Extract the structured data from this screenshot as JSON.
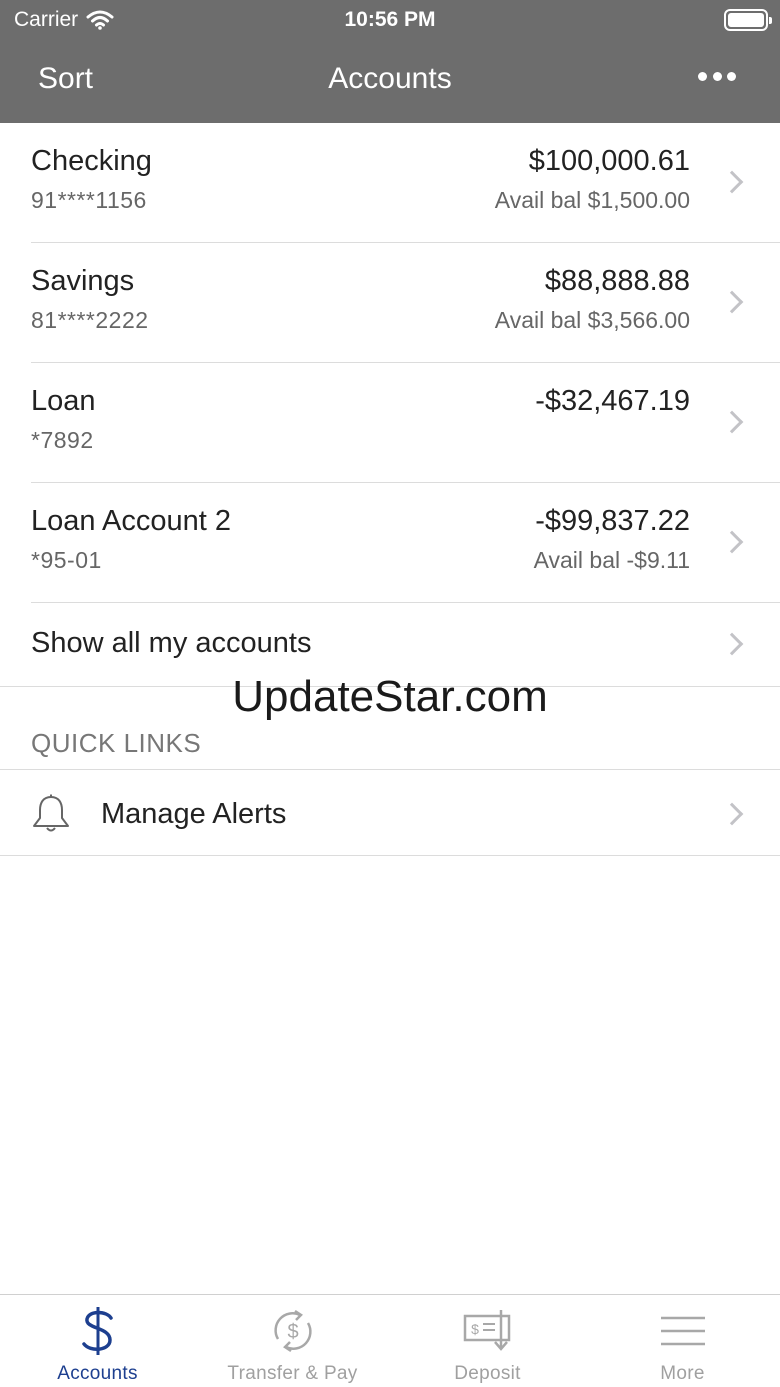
{
  "status_bar": {
    "carrier": "Carrier",
    "time": "10:56 PM"
  },
  "nav": {
    "sort_label": "Sort",
    "title": "Accounts",
    "more_icon": "ellipsis-icon"
  },
  "accounts": [
    {
      "name": "Checking",
      "number": "91****1156",
      "balance": "$100,000.61",
      "available": "Avail bal $1,500.00"
    },
    {
      "name": "Savings",
      "number": "81****2222",
      "balance": "$88,888.88",
      "available": "Avail bal $3,566.00"
    },
    {
      "name": "Loan",
      "number": "*7892",
      "balance": "-$32,467.19",
      "available": ""
    },
    {
      "name": "Loan Account 2",
      "number": "*95-01",
      "balance": "-$99,837.22",
      "available": "Avail bal -$9.11"
    }
  ],
  "show_all_label": "Show all my accounts",
  "watermark": "UpdateStar.com",
  "quick_links": {
    "header": "QUICK LINKS",
    "items": [
      {
        "label": "Manage Alerts",
        "icon": "bell-icon"
      }
    ]
  },
  "tab_bar": {
    "tabs": [
      {
        "label": "Accounts",
        "icon": "dollar-icon",
        "active": true
      },
      {
        "label": "Transfer & Pay",
        "icon": "transfer-icon",
        "active": false
      },
      {
        "label": "Deposit",
        "icon": "check-deposit-icon",
        "active": false
      },
      {
        "label": "More",
        "icon": "menu-icon",
        "active": false
      }
    ]
  },
  "colors": {
    "header_bg": "#6d6d6d",
    "active_tab": "#1d3f8f",
    "inactive_tab": "#a0a0a0"
  }
}
